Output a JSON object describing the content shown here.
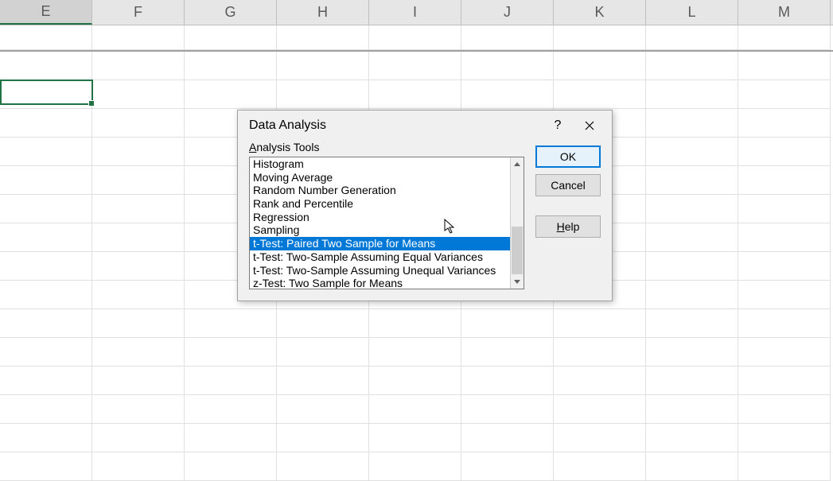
{
  "columns": [
    "E",
    "F",
    "G",
    "H",
    "I",
    "J",
    "K",
    "L",
    "M"
  ],
  "selected_column_index": 0,
  "dialog": {
    "title": "Data Analysis",
    "tools_label_prefix": "A",
    "tools_label_rest": "nalysis Tools",
    "items": [
      "Histogram",
      "Moving Average",
      "Random Number Generation",
      "Rank and Percentile",
      "Regression",
      "Sampling",
      "t-Test: Paired Two Sample for Means",
      "t-Test: Two-Sample Assuming Equal Variances",
      "t-Test: Two-Sample Assuming Unequal Variances",
      "z-Test: Two Sample for Means"
    ],
    "selected_index": 6,
    "buttons": {
      "ok": "OK",
      "cancel": "Cancel",
      "help_accel": "H",
      "help_rest": "elp"
    }
  }
}
